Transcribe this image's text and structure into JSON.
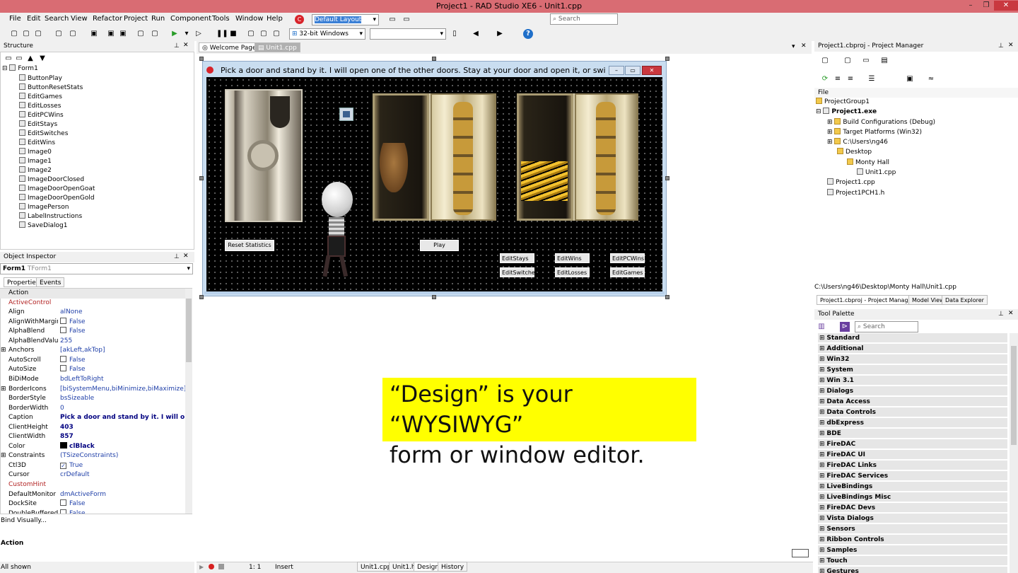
{
  "app": {
    "title": "Project1 - RAD Studio XE6 - Unit1.cpp",
    "window_buttons": [
      "–",
      "❐",
      "✕"
    ]
  },
  "menu": [
    "File",
    "Edit",
    "Search",
    "View",
    "Refactor",
    "Project",
    "Run",
    "Component",
    "Tools",
    "Window",
    "Help"
  ],
  "toolbar": {
    "layout_combo": "Default Layout",
    "platform_combo": "32-bit Windows",
    "search_placeholder": "Search"
  },
  "structure": {
    "title": "Structure",
    "root": "Form1",
    "items": [
      "ButtonPlay",
      "ButtonResetStats",
      "EditGames",
      "EditLosses",
      "EditPCWins",
      "EditStays",
      "EditSwitches",
      "EditWins",
      "Image0",
      "Image1",
      "Image2",
      "ImageDoorClosed",
      "ImageDoorOpenGoat",
      "ImageDoorOpenGold",
      "ImagePerson",
      "LabelInstructions",
      "SaveDialog1"
    ]
  },
  "editor_tabs": [
    "Welcome Page",
    "Unit1.cpp"
  ],
  "form": {
    "caption": "Pick a door and stand by it.  I will open one of the other doors.  Stay at your door and open it, or switch door...",
    "reset_button": "Reset Statistics",
    "play_button": "Play",
    "edits": [
      "EditStays",
      "EditWins",
      "EditPCWins",
      "EditSwitches",
      "EditLosses",
      "EditGames"
    ]
  },
  "callout": {
    "line1": "“Design” is your “WYSIWYG”",
    "line2": "form or window editor.",
    "color": "#ffff00"
  },
  "object_inspector": {
    "title": "Object Inspector",
    "object_name": "Form1",
    "object_type": "TForm1",
    "tabs": [
      "Properties",
      "Events"
    ],
    "props": [
      {
        "n": "Action",
        "v": ""
      },
      {
        "n": "ActiveControl",
        "v": "",
        "red": true
      },
      {
        "n": "Align",
        "v": "alNone"
      },
      {
        "n": "AlignWithMargins",
        "v": "False",
        "chk": ""
      },
      {
        "n": "AlphaBlend",
        "v": "False",
        "chk": ""
      },
      {
        "n": "AlphaBlendValue",
        "v": "255"
      },
      {
        "n": "Anchors",
        "v": "[akLeft,akTop]",
        "exp": true
      },
      {
        "n": "AutoScroll",
        "v": "False",
        "chk": ""
      },
      {
        "n": "AutoSize",
        "v": "False",
        "chk": ""
      },
      {
        "n": "BiDiMode",
        "v": "bdLeftToRight"
      },
      {
        "n": "BorderIcons",
        "v": "[biSystemMenu,biMinimize,biMaximize]",
        "exp": true
      },
      {
        "n": "BorderStyle",
        "v": "bsSizeable"
      },
      {
        "n": "BorderWidth",
        "v": "0"
      },
      {
        "n": "Caption",
        "v": "Pick a door and stand by it.  I will open one",
        "bold": true
      },
      {
        "n": "ClientHeight",
        "v": "403",
        "bold": true
      },
      {
        "n": "ClientWidth",
        "v": "857",
        "bold": true
      },
      {
        "n": "Color",
        "v": "clBlack",
        "bold": true,
        "swatch": true
      },
      {
        "n": "Constraints",
        "v": "(TSizeConstraints)",
        "exp": true
      },
      {
        "n": "Ctl3D",
        "v": "True",
        "chk": "✓"
      },
      {
        "n": "Cursor",
        "v": "crDefault"
      },
      {
        "n": "CustomHint",
        "v": "",
        "red": true
      },
      {
        "n": "DefaultMonitor",
        "v": "dmActiveForm"
      },
      {
        "n": "DockSite",
        "v": "False",
        "chk": ""
      },
      {
        "n": "DoubleBuffered",
        "v": "False",
        "chk": ""
      }
    ],
    "bind_visually": "Bind Visually...",
    "action_label": "Action",
    "all_shown": "All shown"
  },
  "project_manager": {
    "title": "Project1.cbproj - Project Manager",
    "file_label": "File",
    "tree": [
      {
        "t": "ProjectGroup1",
        "l": 0
      },
      {
        "t": "Project1.exe",
        "l": 0,
        "b": true
      },
      {
        "t": "Build Configurations (Debug)",
        "l": 1
      },
      {
        "t": "Target Platforms (Win32)",
        "l": 1
      },
      {
        "t": "C:\\Users\\ng46",
        "l": 1
      },
      {
        "t": "Desktop",
        "l": 2
      },
      {
        "t": "Monty Hall",
        "l": 3
      },
      {
        "t": "Unit1.cpp",
        "l": 4
      },
      {
        "t": "Project1.cpp",
        "l": 1
      },
      {
        "t": "Project1PCH1.h",
        "l": 1
      }
    ],
    "path": "C:\\Users\\ng46\\Desktop\\Monty Hall\\Unit1.cpp",
    "tabs": [
      "Project1.cbproj - Project Manager",
      "Model View",
      "Data Explorer"
    ]
  },
  "tool_palette": {
    "title": "Tool Palette",
    "search_placeholder": "Search",
    "categories": [
      "Standard",
      "Additional",
      "Win32",
      "System",
      "Win 3.1",
      "Dialogs",
      "Data Access",
      "Data Controls",
      "dbExpress",
      "BDE",
      "FireDAC",
      "FireDAC UI",
      "FireDAC Links",
      "FireDAC Services",
      "LiveBindings",
      "LiveBindings Misc",
      "FireDAC Devs",
      "Vista Dialogs",
      "Sensors",
      "Ribbon Controls",
      "Samples",
      "Touch",
      "Gestures"
    ]
  },
  "status": {
    "position": "1:  1",
    "mode": "Insert",
    "tabs": [
      "Unit1.cpp",
      "Unit1.h",
      "Design",
      "History"
    ]
  }
}
